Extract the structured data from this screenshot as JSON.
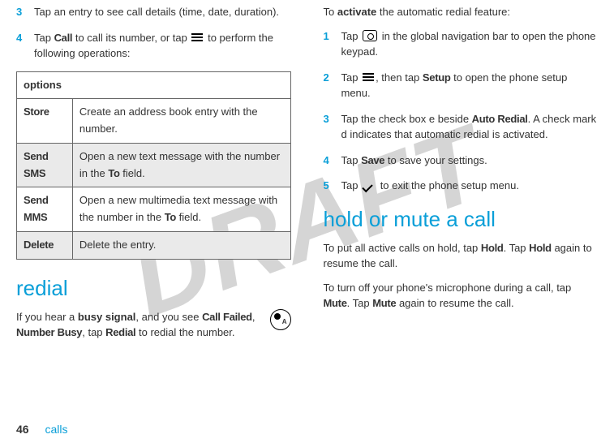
{
  "watermark": "DRAFT",
  "left": {
    "step3": {
      "num": "3",
      "text_a": "Tap an entry to see call details (time, date, duration)."
    },
    "step4": {
      "num": "4",
      "text_a": "Tap ",
      "call": "Call",
      "text_b": " to call its number, or tap ",
      "text_c": " to perform the following operations:"
    },
    "table": {
      "header": "options",
      "rows": [
        {
          "name": "Store",
          "desc": "Create an address book entry with the number."
        },
        {
          "name": "Send SMS",
          "desc_a": "Open a new text message with the number in the ",
          "to": "To",
          "desc_b": " field."
        },
        {
          "name": "Send MMS",
          "desc_a": "Open a new multimedia text message with the number in the ",
          "to": "To",
          "desc_b": " field."
        },
        {
          "name": "Delete",
          "desc": "Delete the entry."
        }
      ]
    },
    "redial_heading": "redial",
    "redial": {
      "text_a": "If you hear a ",
      "busy": "busy signal",
      "text_b": ", and you see ",
      "cf": "Call Failed",
      "text_c": ", ",
      "nb": "Number Busy",
      "text_d": ", tap ",
      "redial": "Redial",
      "text_e": " to redial the number."
    }
  },
  "right": {
    "intro_a": "To ",
    "activate": "activate",
    "intro_b": " the automatic redial feature:",
    "s1": {
      "num": "1",
      "a": "Tap ",
      "b": " in the global navigation bar to open the phone keypad."
    },
    "s2": {
      "num": "2",
      "a": "Tap ",
      "b": ", then tap ",
      "setup": "Setup",
      "c": " to open the phone setup menu."
    },
    "s3": {
      "num": "3",
      "a": "Tap the check box e beside ",
      "ar": "Auto Redial",
      "b": ". A check mark d indicates that automatic redial is activated."
    },
    "s4": {
      "num": "4",
      "a": "Tap ",
      "save": "Save",
      "b": " to save your settings."
    },
    "s5": {
      "num": "5",
      "a": "Tap ",
      "b": " to exit the phone setup menu."
    },
    "hold_heading": "hold or mute a call",
    "hold_para": {
      "a": "To put all active calls on hold, tap ",
      "hold": "Hold",
      "b": ". Tap ",
      "hold2": "Hold",
      "c": " again to resume the call."
    },
    "mute_para": {
      "a": "To turn off your phone's microphone during a call, tap ",
      "mute": "Mute",
      "b": ". Tap ",
      "mute2": "Mute",
      "c": " again to resume the call."
    }
  },
  "footer": {
    "page": "46",
    "section": "calls"
  }
}
